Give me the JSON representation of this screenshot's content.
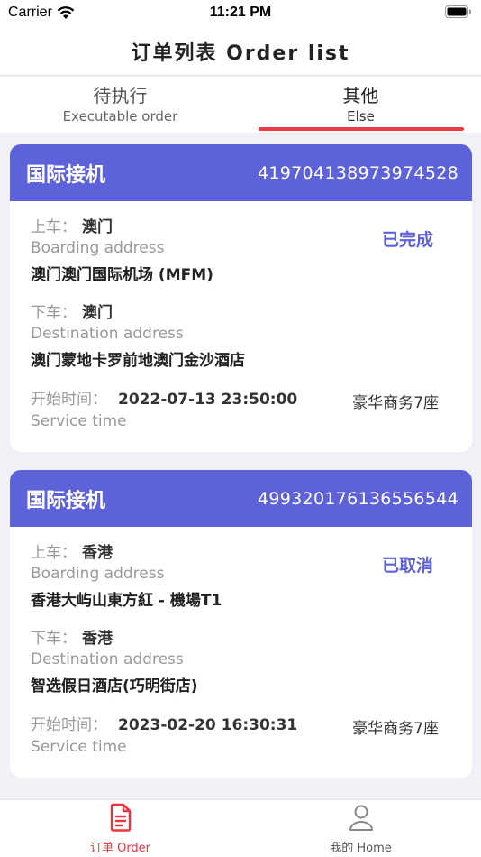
{
  "status_bar": {
    "carrier": "Carrier",
    "time": "11:21 PM"
  },
  "header": {
    "title": "订单列表 Order list"
  },
  "tabs": [
    {
      "label_cn": "待执行",
      "label_en": "Executable order"
    },
    {
      "label_cn": "其他",
      "label_en": "Else"
    }
  ],
  "orders": [
    {
      "type": "国际接机",
      "order_no": "419704138973974528",
      "status": "已完成",
      "boarding_label": "上车：",
      "boarding_city": "澳门",
      "boarding_en": "Boarding address",
      "boarding_addr": "澳门澳门国际机场 (MFM)",
      "dest_label": "下车：",
      "dest_city": "澳门",
      "dest_en": "Destination address",
      "dest_addr": "澳门蒙地卡罗前地澳门金沙酒店",
      "time_label": "开始时间：",
      "time_value": "2022-07-13 23:50:00",
      "time_en": "Service time",
      "car": "豪华商务7座"
    },
    {
      "type": "国际接机",
      "order_no": "499320176136556544",
      "status": "已取消",
      "boarding_label": "上车：",
      "boarding_city": "香港",
      "boarding_en": "Boarding address",
      "boarding_addr": "香港大屿山東方紅 - 機場T1",
      "dest_label": "下车：",
      "dest_city": "香港",
      "dest_en": "Destination address",
      "dest_addr": "智选假日酒店(巧明街店)",
      "time_label": "开始时间：",
      "time_value": "2023-02-20 16:30:31",
      "time_en": "Service time",
      "car": "豪华商务7座"
    }
  ],
  "tabbar": [
    {
      "label": "订单 Order",
      "icon": "document-icon"
    },
    {
      "label": "我的 Home",
      "icon": "person-icon"
    }
  ],
  "colors": {
    "accent": "#5d62d8",
    "active_red": "#e8353f",
    "tab_underline": "#e73a42"
  }
}
